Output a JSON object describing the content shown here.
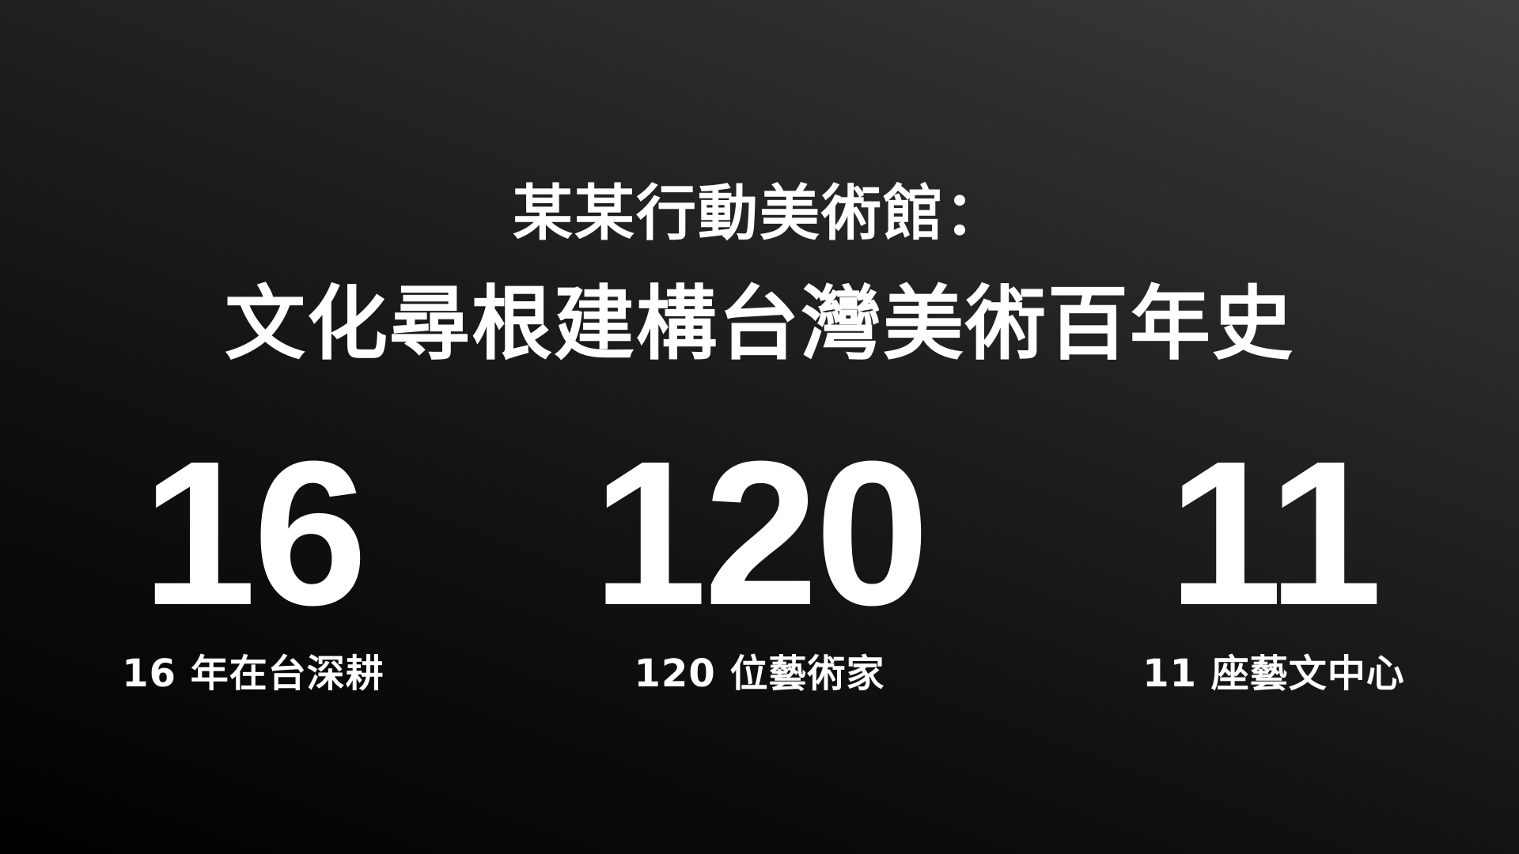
{
  "title": {
    "line1": "某某行動美術館：",
    "line2": "文化尋根建構台灣美術百年史"
  },
  "stats": [
    {
      "number": "16",
      "caption": "16 年在台深耕"
    },
    {
      "number": "120",
      "caption": "120 位藝術家"
    },
    {
      "number": "11",
      "caption": "11 座藝文中心"
    }
  ],
  "colors": {
    "text": "#ffffff",
    "background_top_right": "#3c3c3c",
    "background_bottom_left": "#000000"
  }
}
